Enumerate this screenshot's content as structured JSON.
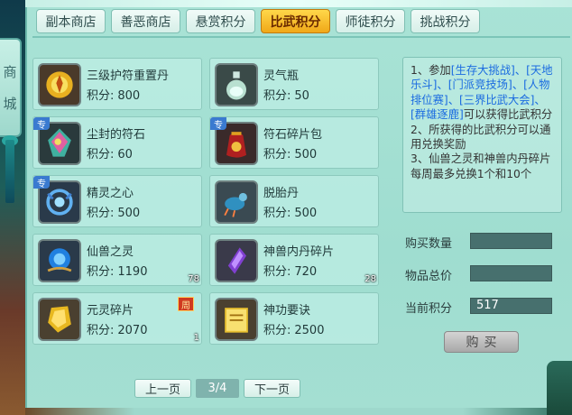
{
  "sidebar": {
    "shop_char1": "商",
    "shop_char2": "城"
  },
  "tabs": [
    {
      "label": "副本商店",
      "active": false
    },
    {
      "label": "善恶商店",
      "active": false
    },
    {
      "label": "悬赏积分",
      "active": false
    },
    {
      "label": "比武积分",
      "active": true
    },
    {
      "label": "师徒积分",
      "active": false
    },
    {
      "label": "挑战积分",
      "active": false
    }
  ],
  "price_label": "积分:",
  "items": [
    {
      "name": "三级护符重置丹",
      "price": "800",
      "icon": "amulet-pill-icon"
    },
    {
      "name": "灵气瓶",
      "price": "50",
      "icon": "spirit-bottle-icon"
    },
    {
      "name": "尘封的符石",
      "price": "60",
      "icon": "sealed-rune-stone-icon",
      "badge": "专"
    },
    {
      "name": "符石碎片包",
      "price": "500",
      "icon": "rune-fragment-bag-icon",
      "badge": "专"
    },
    {
      "name": "精灵之心",
      "price": "500",
      "icon": "spirit-heart-icon",
      "badge": "专"
    },
    {
      "name": "脱胎丹",
      "price": "500",
      "icon": "rebirth-pill-icon"
    },
    {
      "name": "仙兽之灵",
      "price": "1190",
      "icon": "beast-soul-orb-icon",
      "count": "78"
    },
    {
      "name": "神兽内丹碎片",
      "price": "720",
      "icon": "beast-core-fragment-icon",
      "count": "28"
    },
    {
      "name": "元灵碎片",
      "price": "2070",
      "icon": "yuanling-fragment-icon",
      "count": "1",
      "week": "周"
    },
    {
      "name": "神功要诀",
      "price": "2500",
      "icon": "skill-manual-icon"
    }
  ],
  "info": {
    "l1_a": "1、参加",
    "l1_b": "[生存大挑战]、[天地乐斗]、[门派竞技场]、[人物排位赛]、[三界比武大会]、[群雄逐鹿]",
    "l1_c": "可以获得比武积分",
    "l2": "2、所获得的比武积分可以通用兑换奖励",
    "l3": "3、仙兽之灵和神兽内丹碎片每周最多兑换1个和10个"
  },
  "form": {
    "qty_label": "购买数量",
    "qty_value": "",
    "total_label": "物品总价",
    "total_value": "",
    "points_label": "当前积分",
    "points_value": "517",
    "buy_label": "购买"
  },
  "pager": {
    "prev": "上一页",
    "page": "3/4",
    "next": "下一页"
  }
}
